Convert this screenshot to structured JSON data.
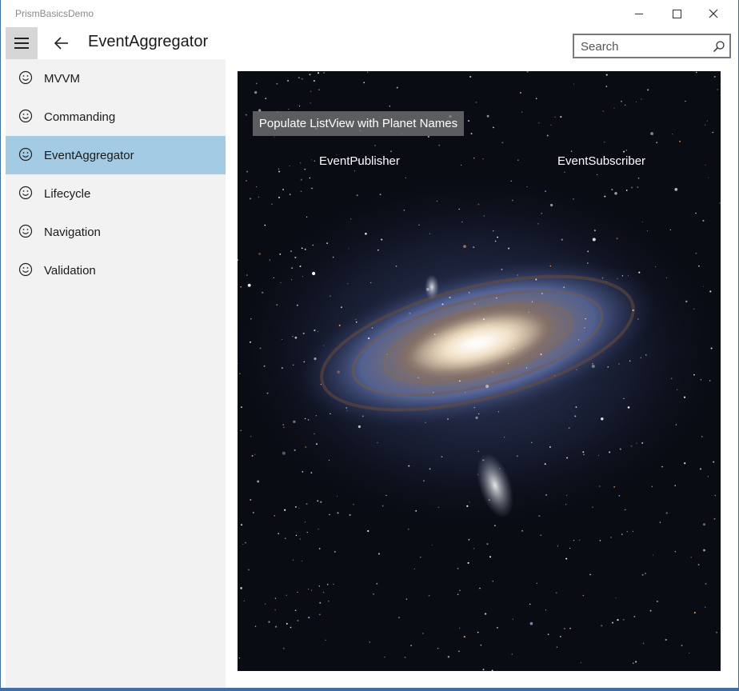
{
  "window": {
    "app_title": "PrismBasicsDemo"
  },
  "header": {
    "page_title": "EventAggregator",
    "search_placeholder": "Search"
  },
  "sidebar": {
    "items": [
      {
        "label": "MVVM",
        "icon": "smiley-icon",
        "selected": false
      },
      {
        "label": "Commanding",
        "icon": "smiley-icon",
        "selected": false
      },
      {
        "label": "EventAggregator",
        "icon": "smiley-icon",
        "selected": true
      },
      {
        "label": "Lifecycle",
        "icon": "smiley-icon",
        "selected": false
      },
      {
        "label": "Navigation",
        "icon": "smiley-icon",
        "selected": false
      },
      {
        "label": "Validation",
        "icon": "smiley-icon",
        "selected": false
      }
    ]
  },
  "main": {
    "populate_button_label": "Populate ListView with Planet Names",
    "publisher_label": "EventPublisher",
    "subscriber_label": "EventSubscriber"
  },
  "colors": {
    "selected_item": "#a4cbe4",
    "sidebar_bg": "#f2f2f2",
    "hamburger_bg": "#d6d6d6",
    "window_border": "#3f6fa5"
  }
}
